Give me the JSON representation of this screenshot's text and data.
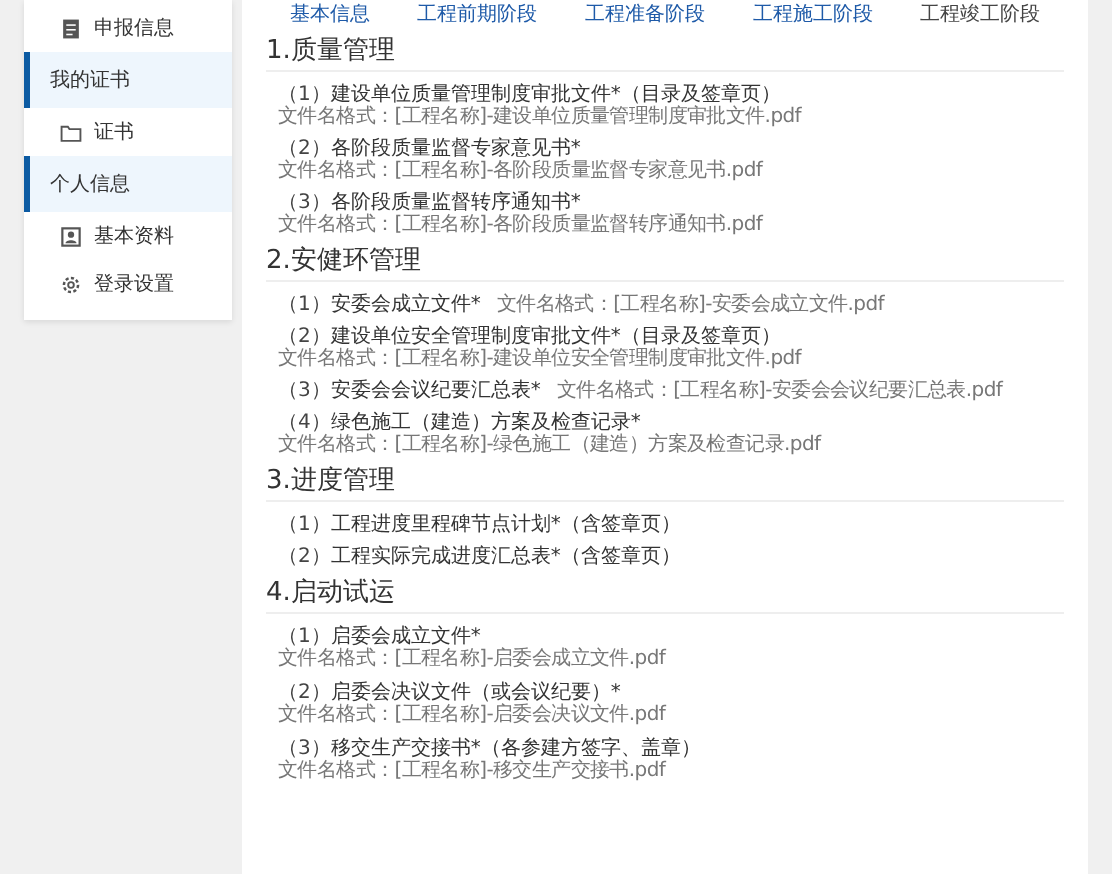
{
  "sidebar": {
    "items": [
      {
        "kind": "document",
        "label": "申报信息"
      },
      {
        "kind": "group",
        "label": "我的证书"
      },
      {
        "kind": "folder",
        "label": "证书"
      },
      {
        "kind": "group",
        "label": "个人信息"
      },
      {
        "kind": "profile",
        "label": "基本资料"
      },
      {
        "kind": "settings",
        "label": "登录设置"
      }
    ]
  },
  "tabs": [
    {
      "label": "基本信息",
      "selected": false
    },
    {
      "label": "工程前期阶段",
      "selected": false
    },
    {
      "label": "工程准备阶段",
      "selected": false
    },
    {
      "label": "工程施工阶段",
      "selected": false
    },
    {
      "label": "工程竣工阶段",
      "selected": true
    }
  ],
  "sections": [
    {
      "title": "1.质量管理",
      "items": [
        {
          "kind": "inline",
          "number": "（1）",
          "title": "建设单位质量管理制度审批文件*（目录及签章页）",
          "format": "文件名格式：[工程名称]-建设单位质量管理制度审批文件.pdf"
        },
        {
          "kind": "inline",
          "number": "（2）",
          "title": "各阶段质量监督专家意见书*",
          "format": "文件名格式：[工程名称]-各阶段质量监督专家意见书.pdf"
        },
        {
          "kind": "inline",
          "number": "（3）",
          "title": "各阶段质量监督转序通知书*",
          "format": "文件名格式：[工程名称]-各阶段质量监督转序通知书.pdf"
        }
      ]
    },
    {
      "title": "2.安健环管理",
      "items": [
        {
          "kind": "inline",
          "number": "（1）",
          "title": "安委会成立文件*",
          "format": "文件名格式：[工程名称]-安委会成立文件.pdf"
        },
        {
          "kind": "inline",
          "number": "（2）",
          "title": "建设单位安全管理制度审批文件*（目录及签章页）",
          "format": "文件名格式：[工程名称]-建设单位安全管理制度审批文件.pdf"
        },
        {
          "kind": "inline",
          "number": "（3）",
          "title": "安委会会议纪要汇总表*",
          "format": "文件名格式：[工程名称]-安委会会议纪要汇总表.pdf"
        },
        {
          "kind": "inline",
          "number": "（4）",
          "title": "绿色施工（建造）方案及检查记录*",
          "format": "文件名格式：[工程名称]-绿色施工（建造）方案及检查记录.pdf"
        }
      ]
    },
    {
      "title": "3.进度管理",
      "items": [
        {
          "kind": "inline",
          "number": "（1）",
          "title": "工程进度里程碑节点计划*（含签章页）"
        },
        {
          "kind": "inline",
          "number": "（2）",
          "title": "工程实际完成进度汇总表*（含签章页）"
        }
      ]
    },
    {
      "title": "4.启动试运",
      "items": [
        {
          "kind": "stacked",
          "number": "（1）",
          "title": "启委会成立文件*",
          "format": "文件名格式：[工程名称]-启委会成立文件.pdf"
        },
        {
          "kind": "stacked",
          "number": "（2）",
          "title": "启委会决议文件（或会议纪要）*",
          "format": "文件名格式：[工程名称]-启委会决议文件.pdf"
        },
        {
          "kind": "stacked",
          "number": "（3）",
          "title": "移交生产交接书*（各参建方签字、盖章）",
          "format": "文件名格式：[工程名称]-移交生产交接书.pdf"
        }
      ]
    }
  ]
}
